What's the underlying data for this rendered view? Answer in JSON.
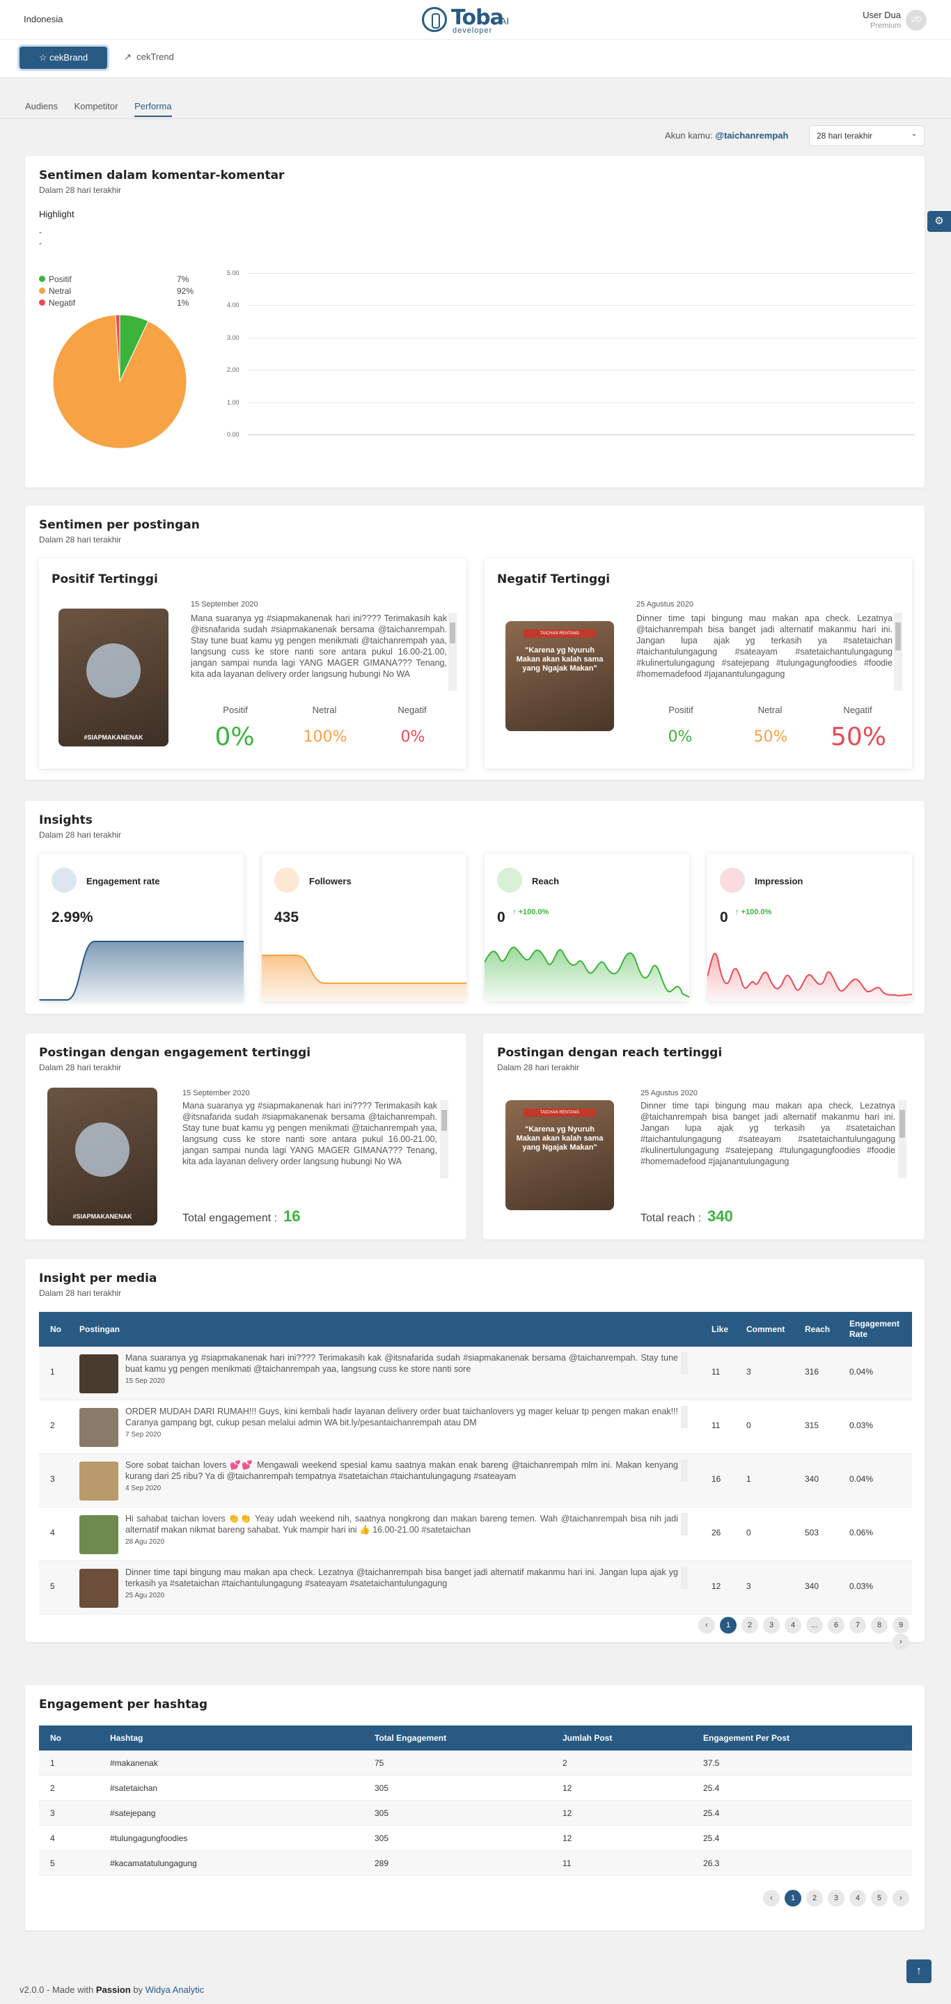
{
  "header": {
    "country": "Indonesia",
    "logo": "Toba",
    "logo_ai": "AI",
    "logo_sub": "developer",
    "user_name": "User Dua",
    "user_role": "Premium",
    "avatar_initials": "UD"
  },
  "subnav": {
    "cekbrand": "cekBrand",
    "cektrend": "cekTrend"
  },
  "tabs": [
    "Audiens",
    "Kompetitor",
    "Performa"
  ],
  "account": {
    "label": "Akun kamu:",
    "handle": "@taichanrempah",
    "period": "28 hari terakhir"
  },
  "sentimen": {
    "title": "Sentimen dalam komentar-komentar",
    "subtitle": "Dalam 28 hari terakhir",
    "highlight": "Highlight",
    "hl1": "-",
    "hl2": "-",
    "legend": [
      {
        "label": "Positif",
        "pct": "7%",
        "color": "#3bb33b"
      },
      {
        "label": "Netral",
        "pct": "92%",
        "color": "#f7a244"
      },
      {
        "label": "Negatif",
        "pct": "1%",
        "color": "#e84b55"
      }
    ]
  },
  "chart_data": {
    "type": "line",
    "yticks": [
      "5.00",
      "4.00",
      "3.00",
      "2.00",
      "1.00",
      "0.00"
    ],
    "ylim": [
      0,
      5
    ],
    "series": []
  },
  "pie_data": {
    "type": "pie",
    "values": [
      7,
      92,
      1
    ],
    "colors": [
      "#3bb33b",
      "#f7a244",
      "#e84b55"
    ]
  },
  "per_post": {
    "title": "Sentimen per postingan",
    "subtitle": "Dalam 28 hari terakhir",
    "pos": {
      "title": "Positif Tertinggi",
      "date": "15 September 2020",
      "text": "Mana suaranya yg #siapmakanenak hari ini???? Terimakasih kak @itsnafarida sudah #siapmakanenak bersama @taichanrempah. Stay tune buat kamu yg pengen menikmati @taichanrempah yaa, langsung cuss ke store nanti sore antara pukul 16.00-21.00, jangan sampai nunda lagi YANG MAGER GIMANA??? Tenang, kita ada layanan delivery order langsung hubungi No WA",
      "l1": "Positif",
      "l2": "Netral",
      "l3": "Negatif",
      "v1": "0%",
      "v2": "100%",
      "v3": "0%"
    },
    "neg": {
      "title": "Negatif Tertinggi",
      "date": "25 Agustus 2020",
      "text": "Dinner time tapi bingung mau makan apa check. Lezatnya @taichanrempah bisa banget jadi alternatif makanmu hari ini. Jangan lupa ajak yg terkasih ya #satetaichan #taichantulungagung #sateayam #satetaichantulungagung #kulinertulungagung #satejepang #tulungagungfoodies #foodie #homemadefood #jajanantulungagung",
      "l1": "Positif",
      "l2": "Netral",
      "l3": "Negatif",
      "v1": "0%",
      "v2": "50%",
      "v3": "50%",
      "img_text": "\"Karena yg Nyuruh Makan akan kalah sama yang Ngajak Makan\"",
      "img_tag": "TAICHAN RENTANG"
    }
  },
  "insights": {
    "title": "Insights",
    "subtitle": "Dalam 28 hari terakhir",
    "items": [
      {
        "label": "Engagement rate",
        "value": "2.99%",
        "change": ""
      },
      {
        "label": "Followers",
        "value": "435",
        "change": ""
      },
      {
        "label": "Reach",
        "value": "0",
        "change": "+100.0%"
      },
      {
        "label": "Impression",
        "value": "0",
        "change": "+100.0%"
      }
    ]
  },
  "top_eng": {
    "title": "Postingan dengan engagement tertinggi",
    "subtitle": "Dalam 28 hari terakhir",
    "date": "15 September 2020",
    "text": "Mana suaranya yg #siapmakanenak hari ini???? Terimakasih kak @itsnafarida sudah #siapmakanenak bersama @taichanrempah. Stay tune buat kamu yg pengen menikmati @taichanrempah yaa, langsung cuss ke store nanti sore antara pukul 16.00-21.00, jangan sampai nunda lagi YANG MAGER GIMANA??? Tenang, kita ada layanan delivery order langsung hubungi No WA",
    "total_label": "Total engagement :",
    "total": "16"
  },
  "top_reach": {
    "title": "Postingan dengan reach tertinggi",
    "subtitle": "Dalam 28 hari terakhir",
    "date": "25 Agustus 2020",
    "text": "Dinner time tapi bingung mau makan apa check. Lezatnya @taichanrempah bisa banget jadi alternatif makanmu hari ini. Jangan lupa ajak yg terkasih ya #satetaichan #taichantulungagung #sateayam #satetaichantulungagung #kulinertulungagung #satejepang #tulungagungfoodies #foodie #homemadefood #jajanantulungagung",
    "total_label": "Total reach :",
    "total": "340"
  },
  "media": {
    "title": "Insight per media",
    "subtitle": "Dalam 28 hari terakhir",
    "cols": [
      "No",
      "Postingan",
      "Like",
      "Comment",
      "Reach",
      "Engagement Rate"
    ],
    "rows": [
      {
        "no": "1",
        "text": "Mana suaranya yg #siapmakanenak hari ini???? Terimakasih kak @itsnafarida sudah #siapmakanenak bersama @taichanrempah. Stay tune buat kamu yg pengen menikmati @taichanrempah yaa, langsung cuss ke store nanti sore",
        "date": "15 Sep 2020",
        "like": "11",
        "comment": "3",
        "reach": "316",
        "er": "0.04%"
      },
      {
        "no": "2",
        "text": "ORDER MUDAH DARI RUMAH!!! Guys, kini kembali hadir layanan delivery order buat taichanlovers yg mager keluar tp pengen makan enak!!! Caranya gampang bgt, cukup pesan melalui admin WA bit.ly/pesantaichanrempah atau DM",
        "date": "7 Sep 2020",
        "like": "11",
        "comment": "0",
        "reach": "315",
        "er": "0.03%"
      },
      {
        "no": "3",
        "text": "Sore sobat taichan lovers 💕💕 Mengawali weekend spesial kamu saatnya makan enak bareng @taichanrempah mlm ini. Makan kenyang kurang dari 25 ribu? Ya di @taichanrempah tempatnya #satetaichan #taichantulungagung #sateayam",
        "date": "4 Sep 2020",
        "like": "16",
        "comment": "1",
        "reach": "340",
        "er": "0.04%"
      },
      {
        "no": "4",
        "text": "Hi sahabat taichan lovers 👏👏 Yeay udah weekend nih, saatnya nongkrong dan makan bareng temen. Wah @taichanrempah bisa nih jadi alternatif makan nikmat bareng sahabat. Yuk mampir hari ini 👍 16.00-21.00 #satetaichan",
        "date": "28 Agu 2020",
        "like": "26",
        "comment": "0",
        "reach": "503",
        "er": "0.06%"
      },
      {
        "no": "5",
        "text": "Dinner time tapi bingung mau makan apa check. Lezatnya @taichanrempah bisa banget jadi alternatif makanmu hari ini. Jangan lupa ajak yg terkasih ya #satetaichan #taichantulungagung #sateayam #satetaichantulungagung",
        "date": "25 Agu 2020",
        "like": "12",
        "comment": "3",
        "reach": "340",
        "er": "0.03%"
      }
    ],
    "pages": [
      "1",
      "2",
      "3",
      "4",
      "...",
      "6",
      "7",
      "8",
      "9"
    ]
  },
  "hashtag": {
    "title": "Engagement per hashtag",
    "cols": [
      "No",
      "Hashtag",
      "Total Engagement",
      "Jumlah Post",
      "Engagement Per Post"
    ],
    "rows": [
      {
        "no": "1",
        "tag": "#makanenak",
        "total": "75",
        "posts": "2",
        "per": "37.5"
      },
      {
        "no": "2",
        "tag": "#satetaichan",
        "total": "305",
        "posts": "12",
        "per": "25.4"
      },
      {
        "no": "3",
        "tag": "#satejepang",
        "total": "305",
        "posts": "12",
        "per": "25.4"
      },
      {
        "no": "4",
        "tag": "#tulungagungfoodies",
        "total": "305",
        "posts": "12",
        "per": "25.4"
      },
      {
        "no": "5",
        "tag": "#kacamatatulungagung",
        "total": "289",
        "posts": "11",
        "per": "26.3"
      }
    ],
    "pages": [
      "1",
      "2",
      "3",
      "4",
      "5"
    ]
  },
  "footer": {
    "version": "v2.0.0 - Made with",
    "passion": "Passion",
    "by": "by",
    "company": "Widya Analytic"
  },
  "icons": {
    "prev": "‹",
    "next": "›",
    "up": "↑",
    "gear": "⚙",
    "trend": "↗",
    "star": "☆"
  }
}
